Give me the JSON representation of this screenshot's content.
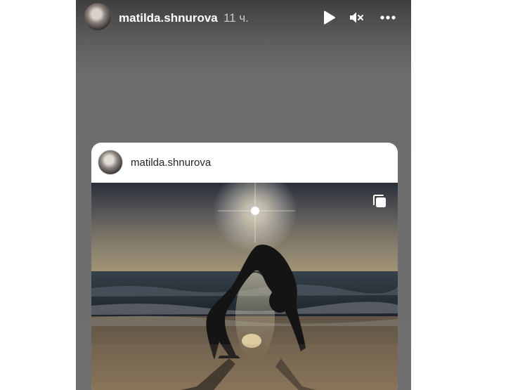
{
  "story": {
    "username": "matilda.shnurova",
    "time_ago": "11 ч.",
    "icons": {
      "play": "play-icon",
      "mute": "muted-speaker-icon",
      "more": "more-options-icon"
    }
  },
  "post_card": {
    "username": "matilda.shnurova",
    "photo_subject": "silhouette of woman in backbend pose on beach at sunset",
    "icons": {
      "carousel": "multiple-photos-icon"
    }
  }
}
